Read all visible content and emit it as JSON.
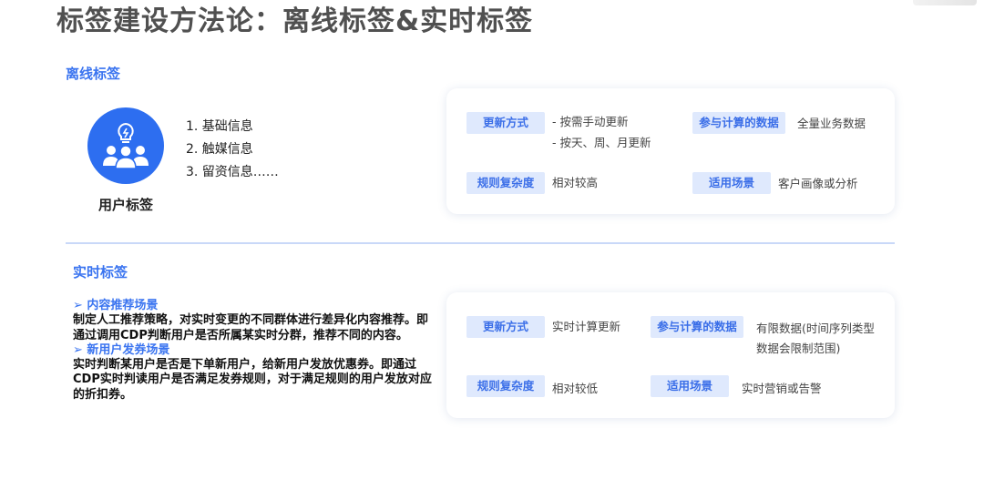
{
  "title": "标签建设方法论：离线标签&实时标签",
  "offline": {
    "section_label": "离线标签",
    "icon": "user-group-icon",
    "caption": "用户标签",
    "list": [
      "1.  基础信息",
      "2.  触媒信息",
      "3.  留资信息……"
    ],
    "card": {
      "update_label": "更新方式",
      "update_value_1": "- 按需手动更新",
      "update_value_2": "- 按天、周、月更新",
      "data_label": "参与计算的数据",
      "data_value": "全量业务数据",
      "complexity_label": "规则复杂度",
      "complexity_value": "相对较高",
      "scene_label": "适用场景",
      "scene_value": "客户画像或分析"
    }
  },
  "realtime": {
    "section_label": "实时标签",
    "scene1_title": "➢ 内容推荐场景",
    "scene1_body": "制定人工推荐策略，对实时变更的不同群体进行差异化内容推荐。即通过调用CDP判断用户是否所属某实时分群，推荐不同的内容。",
    "scene2_title": "➢ 新用户发券场景",
    "scene2_body": "实时判断某用户是否是下单新用户，给新用户发放优惠券。即通过CDP实时判读用户是否满足发券规则，对于满足规则的用户发放对应的折扣券。",
    "card": {
      "update_label": "更新方式",
      "update_value": "实时计算更新",
      "data_label": "参与计算的数据",
      "data_value_1": "有限数据(时间序列类型",
      "data_value_2": "数据会限制范围)",
      "complexity_label": "规则复杂度",
      "complexity_value": "相对较低",
      "scene_label": "适用场景",
      "scene_value": "实时营销或告警"
    }
  },
  "colors": {
    "accent": "#3a74f0",
    "icon_bg": "#2d6ef0",
    "tag_bg": "#dfe9fd",
    "divider": "#c9d8f8"
  }
}
